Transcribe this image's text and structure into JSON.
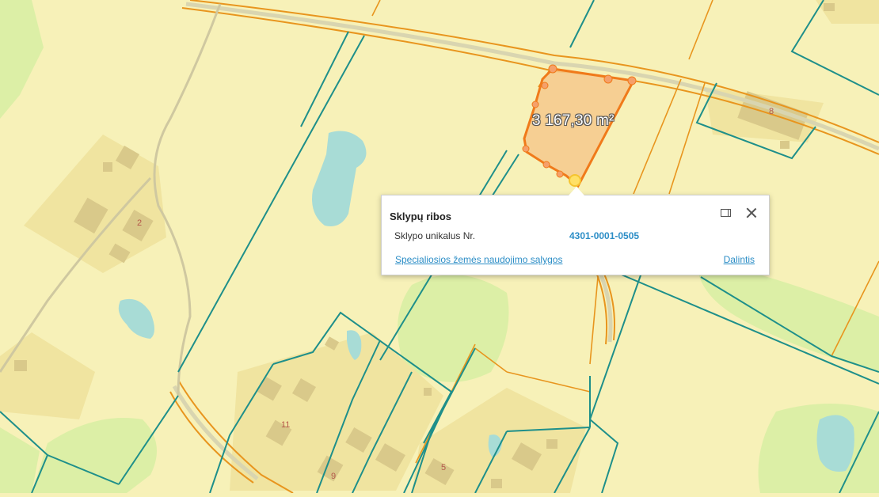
{
  "map": {
    "area_label": "3 167,30 m²",
    "plot_numbers": [
      "2",
      "8",
      "11",
      "9",
      "5"
    ],
    "colors": {
      "background": "#f7f1b8",
      "parcel_border": "#1e8f8a",
      "road_border": "#e8951e",
      "selected_fill": "#f6c98c",
      "selected_border": "#f07a1a",
      "water": "#a8dcd6",
      "vegetation": "#dcefa6",
      "building_zone": "#f0e4a0",
      "building": "#d9c98a"
    }
  },
  "popup": {
    "title": "Sklypų ribos",
    "field_label": "Sklypo unikalus Nr.",
    "field_value": "4301-0001-0505",
    "link_left": "Specialiosios žemės naudojimo sąlygos",
    "link_right": "Dalintis",
    "dock_icon": "dock-panel-icon",
    "close_icon": "close-icon"
  }
}
